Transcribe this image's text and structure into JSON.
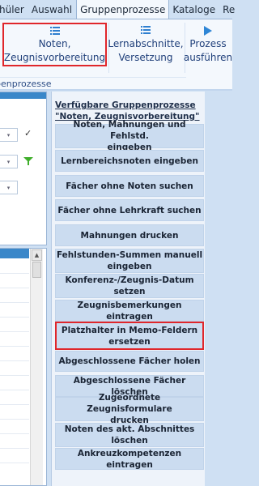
{
  "menu": {
    "tabs": [
      {
        "label": "hüler"
      },
      {
        "label": "Auswahl"
      },
      {
        "label": "Gruppenprozesse"
      },
      {
        "label": "Kataloge"
      },
      {
        "label": "Re"
      }
    ]
  },
  "ribbon": {
    "buttons": [
      {
        "line1": "Noten,",
        "line2": "Zeugnisvorbereitung",
        "icon": "list-icon"
      },
      {
        "line1": "Lernabschnitte,",
        "line2": "Versetzung",
        "icon": "list-icon"
      },
      {
        "line1": "Prozess",
        "line2": "ausführen",
        "icon": "play-icon"
      }
    ],
    "group_label": "penprozesse"
  },
  "panel": {
    "title_line1": "Verfügbare Gruppenprozesse",
    "title_line2": "\"Noten, Zeugnisvorbereitung\"",
    "buttons": [
      {
        "line1": "Noten, Mahnungen und Fehlstd.",
        "line2": "eingeben"
      },
      {
        "line1": "Lernbereichsnoten eingeben",
        "line2": ""
      },
      {
        "line1": "Fächer ohne Noten suchen",
        "line2": ""
      },
      {
        "line1": "Fächer ohne Lehrkraft suchen",
        "line2": ""
      },
      {
        "line1": "Mahnungen drucken",
        "line2": ""
      },
      {
        "line1": "Fehlstunden-Summen manuell",
        "line2": "eingeben"
      },
      {
        "line1": "Konferenz-/Zeugnis-Datum",
        "line2": "setzen"
      },
      {
        "line1": "Zeugnisbemerkungen eintragen",
        "line2": ""
      },
      {
        "line1": "Platzhalter in Memo-Feldern",
        "line2": "ersetzen"
      },
      {
        "line1": "Abgeschlossene Fächer holen",
        "line2": ""
      },
      {
        "line1": "Abgeschlossene Fächer löschen",
        "line2": ""
      },
      {
        "line1": "Zugeordnete Zeugnisformulare",
        "line2": "drucken"
      },
      {
        "line1": "Noten des akt. Abschnittes",
        "line2": "löschen"
      },
      {
        "line1": "Ankreuzkompetenzen eintragen",
        "line2": ""
      }
    ]
  },
  "colors": {
    "highlight": "#e0262b",
    "accent": "#3a87c9",
    "button_bg": "#cbdcf0"
  }
}
